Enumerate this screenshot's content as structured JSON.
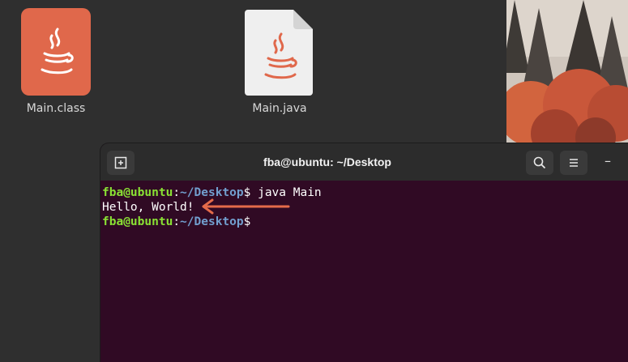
{
  "desktop": {
    "icons": [
      {
        "label": "Main.class",
        "icon": "java-class-file-icon"
      },
      {
        "label": "Main.java",
        "icon": "java-source-file-icon"
      }
    ]
  },
  "terminal": {
    "title": "fba@ubuntu: ~/Desktop",
    "new_tab_icon": "new-tab-icon",
    "search_icon": "search-icon",
    "menu_icon": "hamburger-menu-icon",
    "minimize_label": "–",
    "lines": [
      {
        "user": "fba@ubuntu",
        "sep": ":",
        "path": "~/Desktop",
        "prompt": "$",
        "cmd": " java Main"
      },
      {
        "output": "Hello, World!"
      },
      {
        "user": "fba@ubuntu",
        "sep": ":",
        "path": "~/Desktop",
        "prompt": "$",
        "cmd": ""
      }
    ]
  },
  "colors": {
    "terminal_bg": "#300a24",
    "user_color": "#8ae234",
    "path_color": "#729fcf",
    "annotation_arrow": "#e46b4a",
    "java_icon_orange": "#e0684b"
  }
}
